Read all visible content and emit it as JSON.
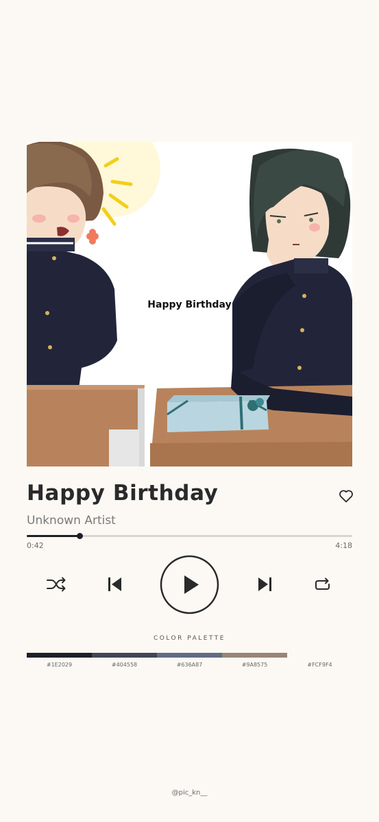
{
  "artwork": {
    "caption": "Happy Birthday"
  },
  "track": {
    "title": "Happy Birthday",
    "artist": "Unknown Artist",
    "liked": false
  },
  "progress": {
    "current": "0:42",
    "total": "4:18",
    "fraction": 0.163
  },
  "controls": {
    "shuffle_icon": "shuffle-icon",
    "previous_icon": "skip-previous-icon",
    "play_icon": "play-icon",
    "next_icon": "skip-next-icon",
    "repeat_icon": "repeat-icon",
    "favorite_icon": "heart-outline-icon"
  },
  "palette": {
    "label": "COLOR PALETTE",
    "colors": [
      "#1E2029",
      "#404558",
      "#636A87",
      "#9A8575",
      "#FCF9F4"
    ],
    "codes": [
      "#1E2029",
      "#404558",
      "#636A87",
      "#9A8575",
      "#FCF9F4"
    ]
  },
  "credit": "@pic_kn__"
}
